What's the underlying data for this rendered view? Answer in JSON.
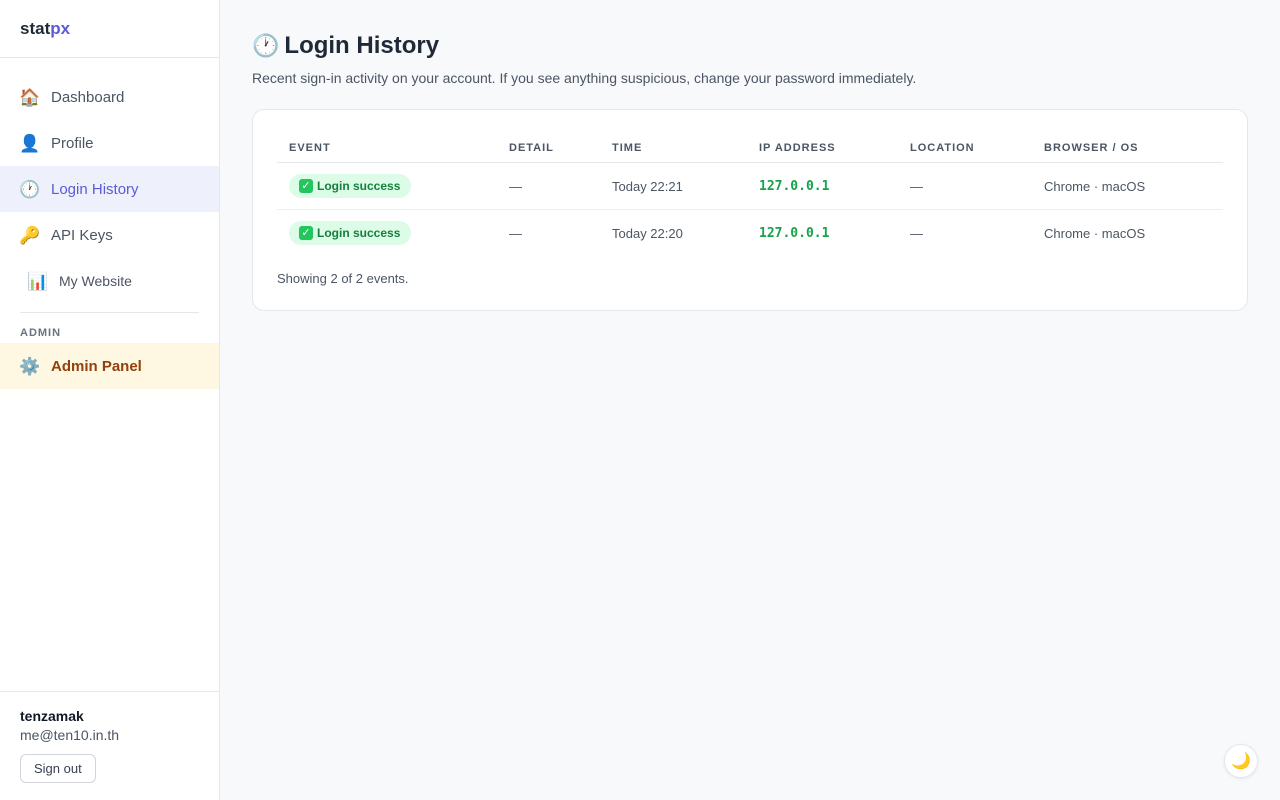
{
  "brand": {
    "part1": "stat",
    "part2": "px"
  },
  "sidebar": {
    "items": [
      {
        "icon": "🏠",
        "label": "Dashboard"
      },
      {
        "icon": "👤",
        "label": "Profile"
      },
      {
        "icon": "🕐",
        "label": "Login History"
      },
      {
        "icon": "🔑",
        "label": "API Keys"
      },
      {
        "icon": "📊",
        "label": "My Website"
      }
    ],
    "section_label": "ADMIN",
    "admin_item": {
      "icon": "⚙️",
      "label": "Admin Panel"
    }
  },
  "user": {
    "name": "tenzamak",
    "email": "me@ten10.in.th",
    "signout_label": "Sign out"
  },
  "page": {
    "icon": "🕐",
    "title": "Login History",
    "subtitle": "Recent sign-in activity on your account. If you see anything suspicious, change your password immediately."
  },
  "table": {
    "headers": [
      "EVENT",
      "DETAIL",
      "TIME",
      "IP ADDRESS",
      "LOCATION",
      "BROWSER / OS"
    ],
    "rows": [
      {
        "event": "Login success",
        "detail": "—",
        "time": "Today 22:21",
        "ip": "127.0.0.1",
        "location": "—",
        "browser": "Chrome · macOS"
      },
      {
        "event": "Login success",
        "detail": "—",
        "time": "Today 22:20",
        "ip": "127.0.0.1",
        "location": "—",
        "browser": "Chrome · macOS"
      }
    ],
    "footer": "Showing 2 of 2 events."
  },
  "theme_toggle_icon": "🌙",
  "colors": {
    "accent": "#5b5bd6",
    "success": "#16a34a",
    "admin": "#92400e"
  }
}
